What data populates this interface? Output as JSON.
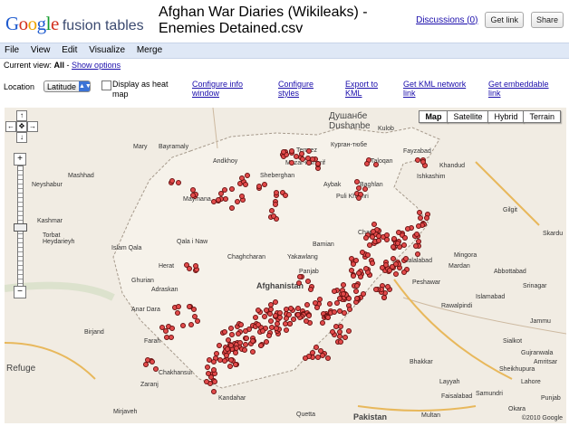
{
  "header": {
    "logo_google": "Google",
    "logo_product": "fusion tables",
    "doc_title": "Afghan War Diaries (Wikileaks) - Enemies Detained.csv",
    "discussions_link": "Discussions (0)",
    "get_link_button": "Get link",
    "share_button": "Share"
  },
  "menubar": {
    "items": [
      "File",
      "View",
      "Edit",
      "Visualize",
      "Merge"
    ]
  },
  "current_view": {
    "prefix": "Current view:",
    "value": "All",
    "sep": " - ",
    "show_options": "Show options"
  },
  "toolbar": {
    "location_label": "Location",
    "location_select": "Latitude",
    "heatmap_label": "Display as heat map",
    "configure_info": "Configure info window",
    "configure_styles": "Configure styles",
    "export_kml": "Export to KML",
    "get_kml_network": "Get KML network link",
    "get_embeddable": "Get embeddable link"
  },
  "map": {
    "types": [
      "Map",
      "Satellite",
      "Hybrid",
      "Terrain"
    ],
    "active_type": "Map",
    "labels": {
      "afghanistan": "Afghanistan",
      "pakistan": "Pakistan",
      "dushanbe": "Душанбе Dushanbe",
      "kurgan": "Курган-тюбе",
      "kulob": "Kulob",
      "mary": "Mary",
      "bayramaly": "Bayramaly",
      "andkhoy": "Andkhoy",
      "mazar": "Mazar-i-Sharif",
      "sheberghan": "Sheberghan",
      "termez": "Termez",
      "taloqan": "Taloqan",
      "fayzabad": "Fayzabad",
      "khorog": "Khorog",
      "aybak": "Aybak",
      "baghlan": "Baghlan",
      "puli_khumri": "Puli Khumri",
      "maymana": "Maymana",
      "chaghcharan": "Chaghcharan",
      "yakawlang": "Yakawlang",
      "bamian": "Bamian",
      "panjab": "Panjab",
      "charikar": "Charikar",
      "jalalabad": "Jalalabad",
      "peshawar": "Peshawar",
      "mardan": "Mardan",
      "abbottabad": "Abbottabad",
      "srinagar": "Srinagar",
      "islamabad": "Islamabad",
      "rawalpindi": "Rawalpindi",
      "jammu": "Jammu",
      "herat": "Herat",
      "islam_qala": "Islam Qala",
      "qala_i_naw": "Qala i Naw",
      "ghurian": "Ghurian",
      "adraskan": "Adraskan",
      "anar_dara": "Anar Dara",
      "farah": "Farah",
      "birjand": "Birjand",
      "zaranj": "Zaranj",
      "chakhansur": "Chakhansur",
      "quetta": "Quetta",
      "faisalabad": "Faisalabad",
      "lahore": "Lahore",
      "amritsar": "Amritsar",
      "sialkot": "Sialkot",
      "gujranwala": "Gujranwala",
      "multan": "Multan",
      "bhakkar": "Bhakkar",
      "mirjaveh": "Mirjaveh",
      "kashmar": "Kashmar",
      "mashhad": "Mashhad",
      "neyshabur": "Neyshabur",
      "torbat": "Torbat Heydarieyh",
      "gilgit": "Gilgit",
      "skardu": "Skardu",
      "mingora": "Mingora",
      "khanabad": "Khandud",
      "ishkashim": "Ishkashim",
      "kandahar": "Kandahar",
      "punjab": "Punjab",
      "samundri": "Samundri",
      "layyah": "Layyah",
      "sheikhupura": "Sheikhupura",
      "okara": "Okara",
      "refugee": "Refuge"
    },
    "copyright": "©2010 Google"
  },
  "colors": {
    "dot_fill": "#e34b4b",
    "dot_border": "#6b1212",
    "menubar_bg": "#dfe8f6",
    "map_bg": "#f1ece3"
  }
}
